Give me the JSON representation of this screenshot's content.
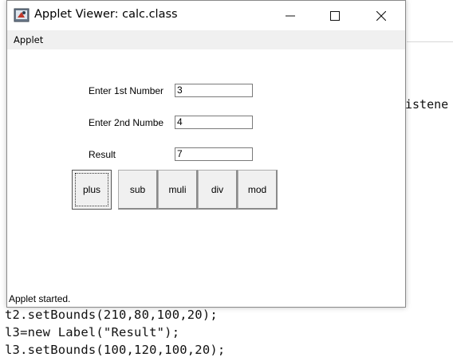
{
  "window": {
    "title": "Applet Viewer: calc.class",
    "menu": "Applet",
    "status": "Applet started."
  },
  "form": {
    "label1": "Enter 1st Number",
    "value1": "3",
    "label2": "Enter 2nd Numbe",
    "value2": "4",
    "label3": "Result",
    "value3": "7"
  },
  "buttons": [
    {
      "label": "plus"
    },
    {
      "label": "sub"
    },
    {
      "label": "muli"
    },
    {
      "label": "div"
    },
    {
      "label": "mod"
    }
  ],
  "editor": {
    "fragment_right": "istene",
    "line1": "t2.setBounds(210,80,100,20);",
    "line2": "l3=new Label(\"Result\");",
    "line3": "l3.setBounds(100,120,100,20);"
  }
}
